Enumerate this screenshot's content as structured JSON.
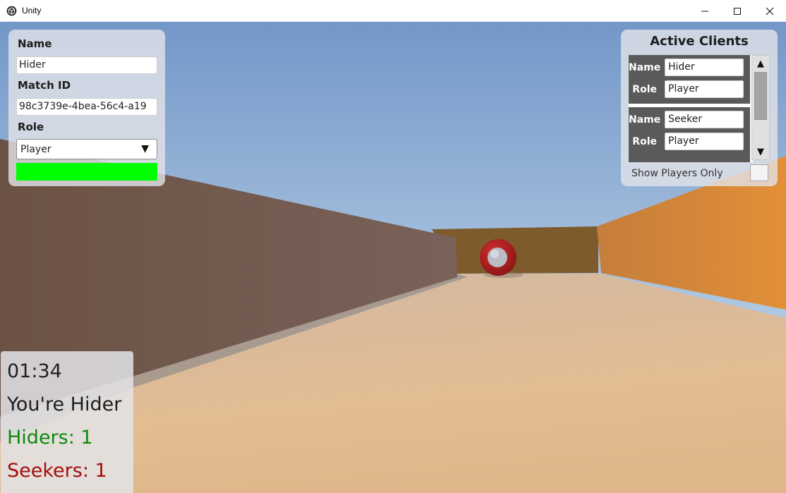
{
  "window": {
    "title": "Unity",
    "icon": "unity-cube-icon",
    "controls": {
      "minimize": "minimize-icon",
      "maximize": "maximize-icon",
      "close": "close-icon"
    }
  },
  "player_panel": {
    "name_label": "Name",
    "name_value": "Hider",
    "match_label": "Match ID",
    "match_value": "98c3739e-4bea-56c4-a19",
    "role_label": "Role",
    "role_selected": "Player",
    "role_arrow": "▼",
    "status_color": "#00ff00"
  },
  "clients_panel": {
    "title": "Active Clients",
    "clients": [
      {
        "name_label": "Name",
        "name": "Hider",
        "role_label": "Role",
        "role": "Player"
      },
      {
        "name_label": "Name",
        "name": "Seeker",
        "role_label": "Role",
        "role": "Player"
      }
    ],
    "scroll_up": "▲",
    "scroll_down": "▼",
    "show_players_label": "Show Players Only",
    "show_players_checked": false
  },
  "hud": {
    "timer": "01:34",
    "role_text": "You're Hider",
    "hiders": "Hiders: 1",
    "seekers": "Seekers: 1",
    "hiders_color": "#0c8a0c",
    "seekers_color": "#a00d0d"
  },
  "scene": {
    "sky_top": "#7a9ccc",
    "sky_bottom": "#c9dae8",
    "left_wall": "#6e5448",
    "right_wall": "#d8883a",
    "back_wall": "#7a5a2e",
    "floor": "#d9b590",
    "ball_color": "#b31b1b"
  }
}
